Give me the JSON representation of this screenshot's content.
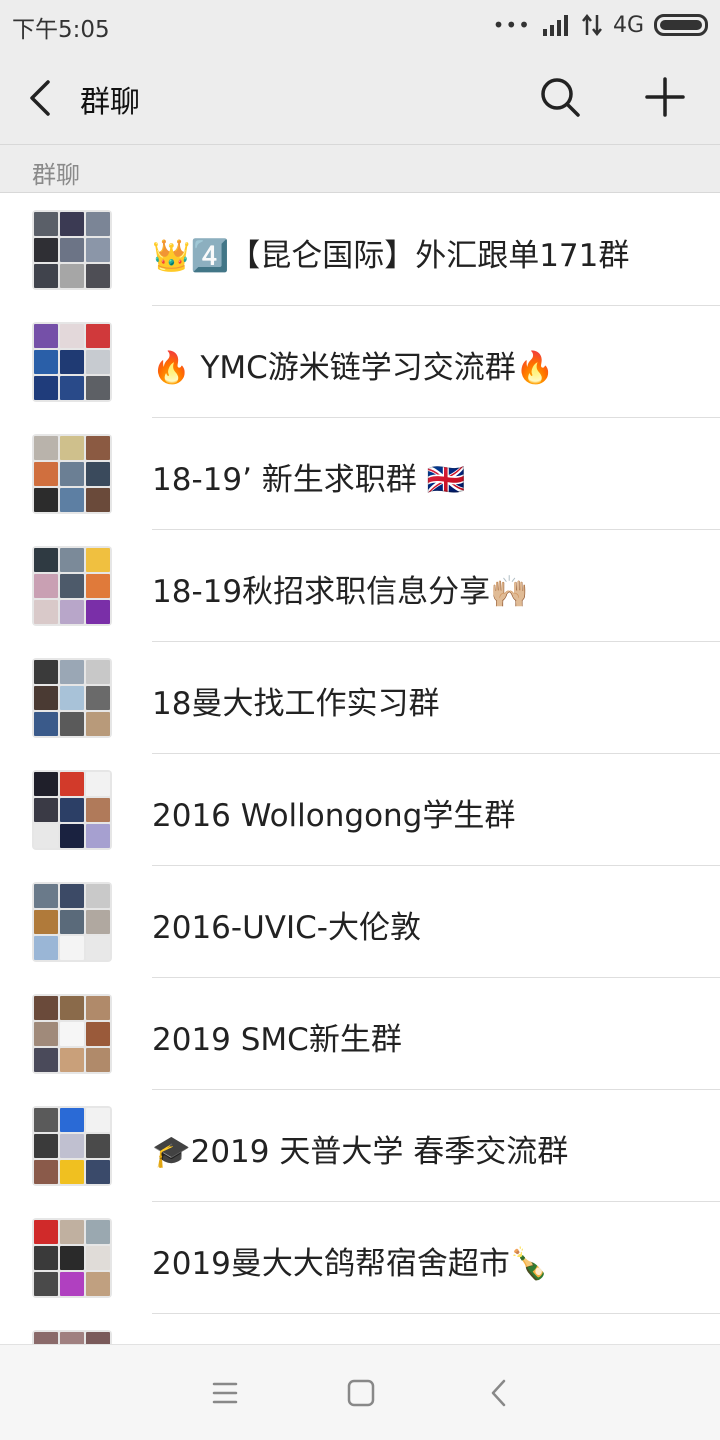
{
  "status_bar": {
    "time": "下午5:05",
    "signal_dots": "•••",
    "network": "4G"
  },
  "header": {
    "title": "群聊",
    "icons": [
      "back-arrow-icon",
      "search-icon",
      "plus-icon"
    ]
  },
  "section": {
    "label": "群聊"
  },
  "groups": [
    {
      "name": "👑4️⃣【昆仑国际】外汇跟单171群",
      "avatar_colors": [
        "#5a5f68",
        "#3b3a53",
        "#7b8596",
        "#2f2f34",
        "#6c7486",
        "#8b96a8",
        "#40434c",
        "#a6a6a6",
        "#4e4e55"
      ]
    },
    {
      "name": "🔥 YMC游米链学习交流群🔥",
      "avatar_colors": [
        "#7550a8",
        "#e3d8da",
        "#d0393b",
        "#2a5fa8",
        "#1f3a73",
        "#c7cbd0",
        "#1f3c7b",
        "#294a89",
        "#5d6065"
      ]
    },
    {
      "name": "18-19’ 新生求职群 🇬🇧",
      "avatar_colors": [
        "#b9b3ab",
        "#cfc08c",
        "#8b5a42",
        "#d06f3e",
        "#6b7f94",
        "#3a4a5c",
        "#2c2c2c",
        "#5d7fa3",
        "#6a4a3a"
      ]
    },
    {
      "name": "18-19秋招求职信息分享🙌🏼",
      "avatar_colors": [
        "#2f3a42",
        "#7b8a99",
        "#f0c040",
        "#c9a0b3",
        "#4d5a6a",
        "#e07a3a",
        "#d9c9c9",
        "#b8a6c9",
        "#7a2fa8"
      ]
    },
    {
      "name": "18曼大找工作实习群",
      "avatar_colors": [
        "#3a3a3a",
        "#9aa7b5",
        "#c8c8c8",
        "#4a3a33",
        "#a8c2d8",
        "#6a6a6a",
        "#3a5a8a",
        "#5a5a5a",
        "#b89a7a"
      ]
    },
    {
      "name": "2016 Wollongong学生群",
      "avatar_colors": [
        "#1f1f2a",
        "#d23a2a",
        "#f2f2f2",
        "#3a3a45",
        "#2c3f66",
        "#b07a5a",
        "#e8e8e8",
        "#1a2240",
        "#a6a0d0"
      ]
    },
    {
      "name": "2016-UVIC-大伦敦",
      "avatar_colors": [
        "#6a7a8a",
        "#3c4a66",
        "#c9c9c9",
        "#b07a3a",
        "#5a6a7a",
        "#b0a8a0",
        "#9ab6d6",
        "#f4f4f4",
        "#e8e8e8"
      ]
    },
    {
      "name": "2019 SMC新生群",
      "avatar_colors": [
        "#6a4a3a",
        "#8a6a4a",
        "#b08a6a",
        "#a08a7a",
        "#f6f6f6",
        "#9a5a3a",
        "#4a4a5a",
        "#c9a07a",
        "#b08a6a"
      ]
    },
    {
      "name": "🎓2019 天普大学  春季交流群",
      "avatar_colors": [
        "#5a5a5a",
        "#2a6ad6",
        "#f2f2f2",
        "#3a3a3a",
        "#c0c0d0",
        "#4a4a4a",
        "#8a5a4a",
        "#f0c020",
        "#3a4a6a"
      ]
    },
    {
      "name": "2019曼大大鸽帮宿舍超市🍾",
      "avatar_colors": [
        "#d02a2a",
        "#c0b0a0",
        "#9aa8b0",
        "#3a3a3a",
        "#2a2a2a",
        "#e0dcd8",
        "#4a4a4a",
        "#b040c0",
        "#c0a080"
      ]
    },
    {
      "name": "",
      "avatar_colors": [
        "#8a6a6a",
        "#a08080",
        "#7a5a5a",
        "#c0b0b0",
        "#d0c0c0",
        "#b0a0a0",
        "#e0e0e0",
        "#e0e0e0",
        "#e0e0e0"
      ]
    }
  ],
  "system_nav": {
    "icons": [
      "menu-icon",
      "home-icon",
      "back-icon"
    ]
  }
}
